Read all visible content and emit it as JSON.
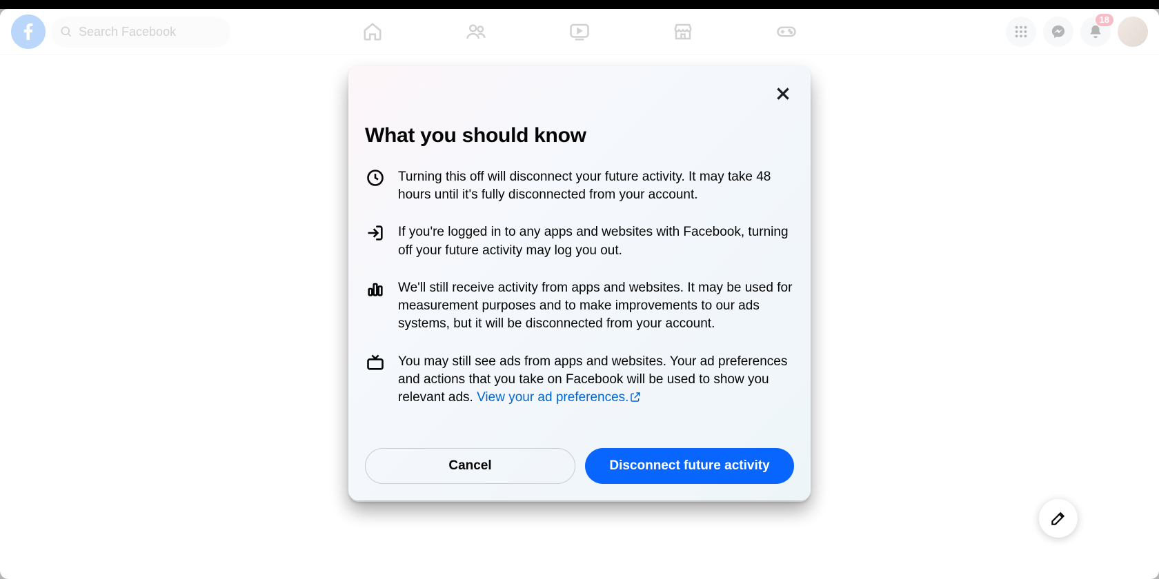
{
  "search": {
    "placeholder": "Search Facebook"
  },
  "notifications": {
    "count": "18"
  },
  "modal": {
    "title": "What you should know",
    "items": [
      {
        "text": "Turning this off will disconnect your future activity. It may take 48 hours until it's fully disconnected from your account."
      },
      {
        "text": "If you're logged in to any apps and websites with Facebook, turning off your future activity may log you out."
      },
      {
        "text": "We'll still receive activity from apps and websites. It may be used for measurement purposes and to make improvements to our ads systems, but it will be disconnected from your account."
      },
      {
        "text": "You may still see ads from apps and websites. Your ad preferences and actions that you take on Facebook will be used to show you relevant ads. "
      }
    ],
    "link_text": "View your ad preferences.",
    "cancel_label": "Cancel",
    "confirm_label": "Disconnect future activity"
  }
}
